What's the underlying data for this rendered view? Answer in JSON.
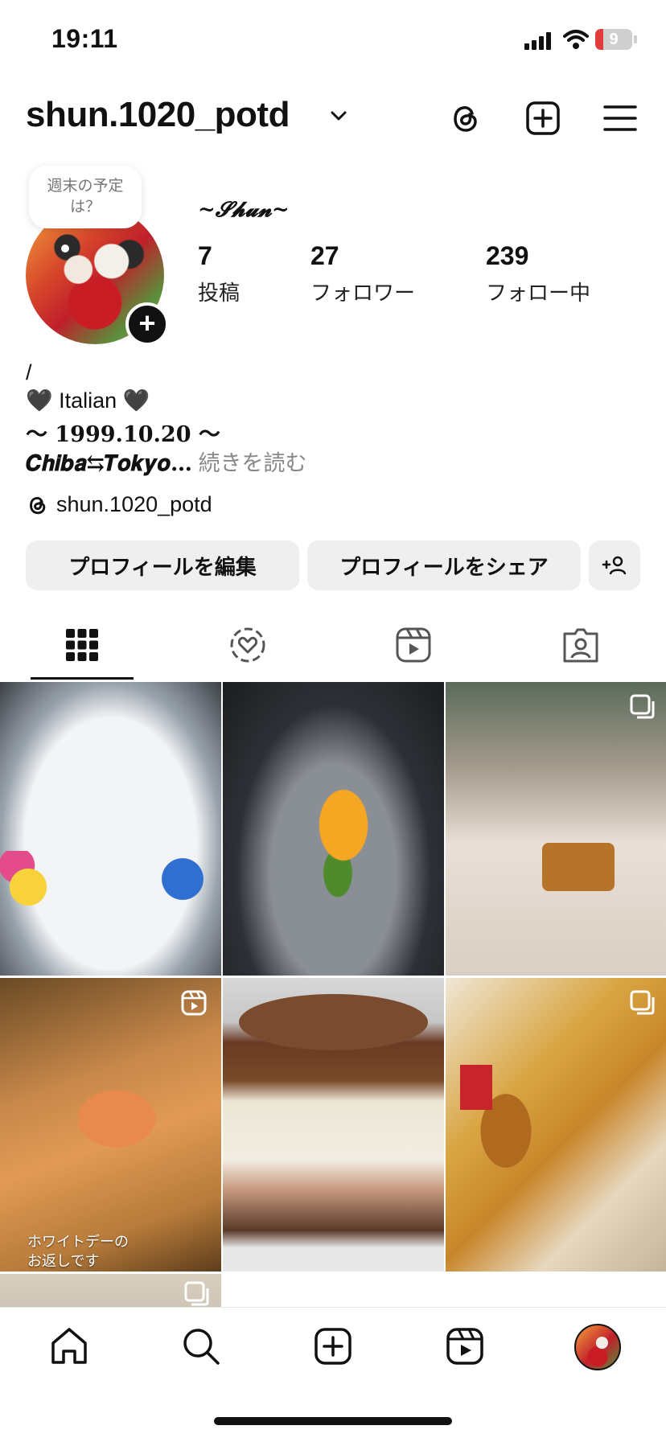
{
  "status_bar": {
    "time": "19:11",
    "battery": "9"
  },
  "header": {
    "username": "shun.1020_potd",
    "icons": [
      "threads-icon",
      "create-plus-icon",
      "menu-icon"
    ]
  },
  "profile": {
    "note_bubble": "週末の予定は？",
    "display_name": "~𝓢𝓱𝓾𝓷~",
    "stats": [
      {
        "value": "7",
        "label": "投稿"
      },
      {
        "value": "27",
        "label": "フォロワー"
      },
      {
        "value": "239",
        "label": "フォロー中"
      }
    ],
    "bio_lines": [
      "/",
      "🖤 Italian 🖤",
      "〜 𝟏𝟗𝟗𝟗.𝟏𝟎.𝟐𝟎 〜"
    ],
    "bio_last": "𝑪𝒉𝒊𝒃𝒂⇆𝑻𝒐𝒌𝒚𝒐…",
    "bio_more": " 続きを読む",
    "threads_handle": "shun.1020_potd"
  },
  "buttons": {
    "edit": "プロフィールを編集",
    "share": "プロフィールをシェア"
  },
  "grid": {
    "cells": [
      {
        "caption": ""
      },
      {
        "caption": ""
      },
      {
        "caption": ""
      },
      {
        "caption": "ホワイトデーの\nお返しです"
      },
      {
        "caption": ""
      },
      {
        "caption": ""
      }
    ]
  },
  "colors": {
    "accent": "#111111",
    "button_bg": "#efefef",
    "battery_low": "#e23b3b"
  }
}
